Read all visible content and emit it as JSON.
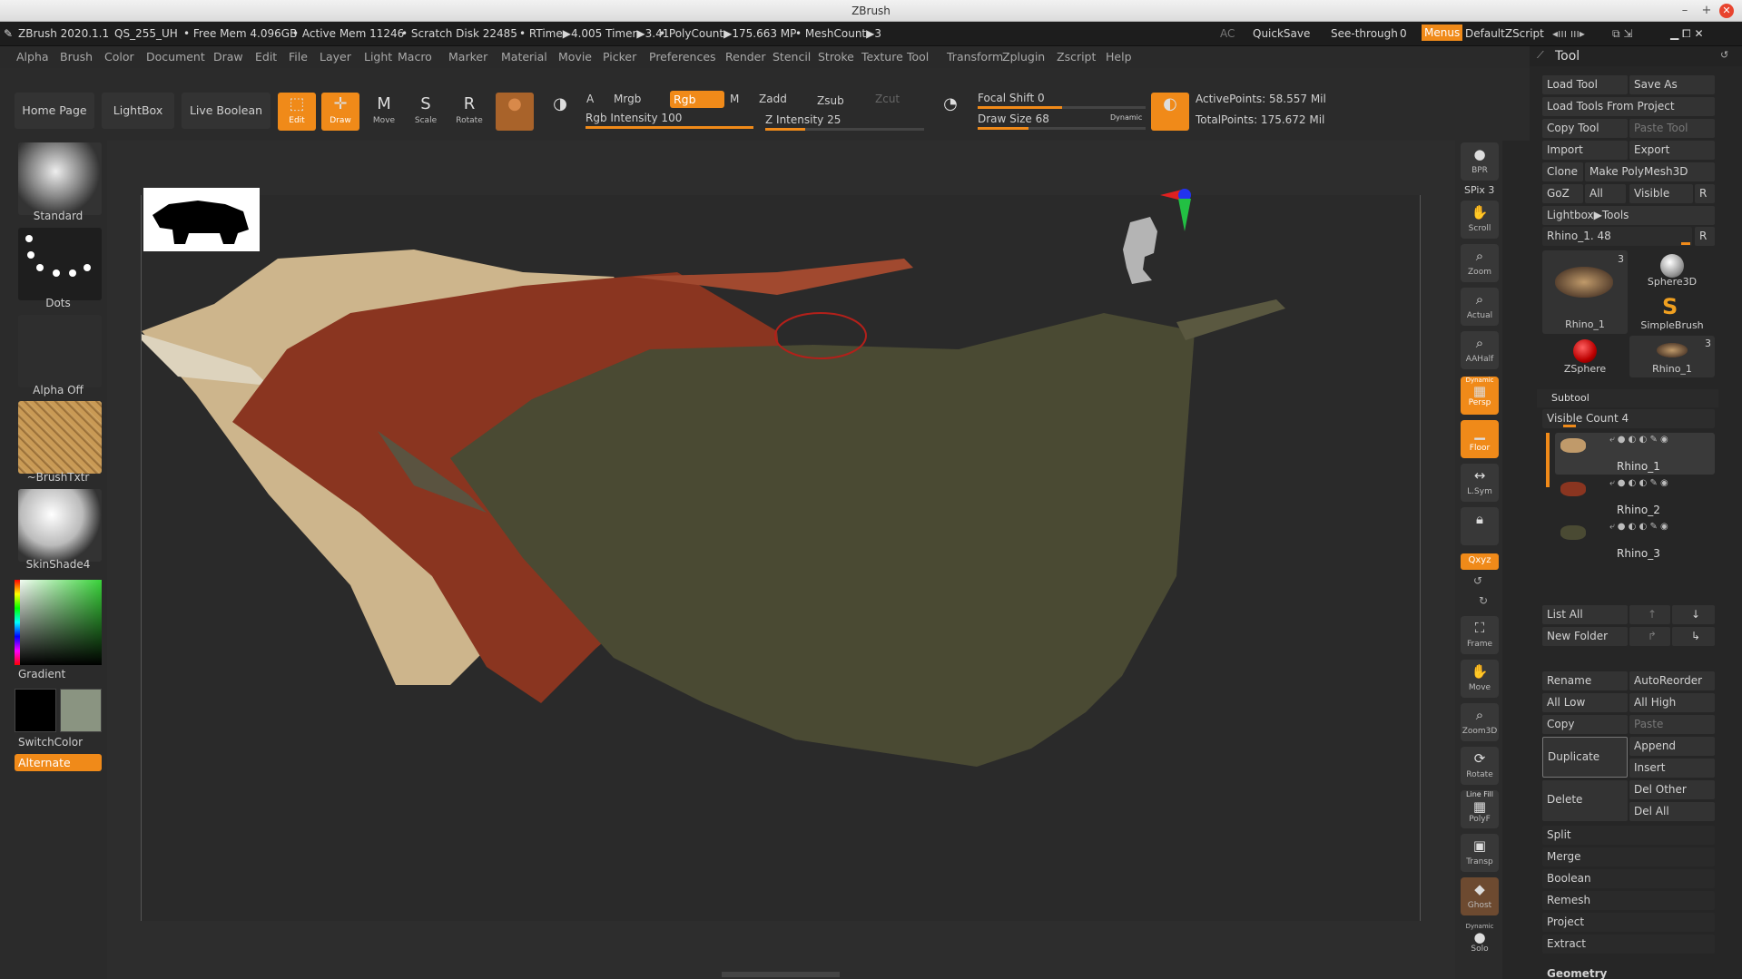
{
  "app": {
    "title": "ZBrush",
    "version": "ZBrush 2020.1.1",
    "script": "QS_255_UH"
  },
  "info": {
    "free_mem": "• Free Mem 4.096GB",
    "active_mem": "• Active Mem 11246",
    "scratch": "• Scratch Disk 22485",
    "rtime": "• RTime▶4.005 Timer▶3.41",
    "polycount": "• PolyCount▶175.663 MP",
    "meshcount": "• MeshCount▶3",
    "ac": "AC",
    "quicksave": "QuickSave",
    "seethrough": "See-through",
    "seethrough_val": "0",
    "menus": "Menus",
    "defaultzscript": "DefaultZScript"
  },
  "menus": [
    "Alpha",
    "Brush",
    "Color",
    "Document",
    "Draw",
    "Edit",
    "File",
    "Layer",
    "Light",
    "Macro",
    "Marker",
    "Material",
    "Movie",
    "Picker",
    "Preferences",
    "Render",
    "Stencil",
    "Stroke",
    "Texture",
    "Tool",
    "Transform",
    "Zplugin",
    "Zscript",
    "Help"
  ],
  "toolbar": {
    "home": "Home Page",
    "lightbox": "LightBox",
    "live_boolean": "Live Boolean",
    "edit": "Edit",
    "draw": "Draw",
    "move": "Move",
    "scale": "Scale",
    "rotate": "Rotate",
    "a": "A",
    "mrgb": "Mrgb",
    "rgb": "Rgb",
    "m": "M",
    "zadd": "Zadd",
    "zsub": "Zsub",
    "zcut": "Zcut",
    "rgb_intensity": "Rgb Intensity 100",
    "z_intensity": "Z Intensity 25",
    "focal_shift": "Focal Shift 0",
    "draw_size": "Draw Size 68",
    "dynamic": "Dynamic",
    "active_points": "ActivePoints: 58.557 Mil",
    "total_points": "TotalPoints: 175.672 Mil",
    "rgb_intensity_level": 1.0,
    "z_intensity_level": 0.25,
    "focal_level": 0.5,
    "draw_size_level": 0.3
  },
  "left": {
    "standard": "Standard",
    "dots": "Dots",
    "alpha_off": "Alpha Off",
    "brushtxtr": "~BrushTxtr",
    "skinshade": "SkinShade4",
    "gradient": "Gradient",
    "switchcolor": "SwitchColor",
    "alternate": "Alternate"
  },
  "right": {
    "bpr": "BPR",
    "spix": "SPix 3",
    "scroll": "Scroll",
    "zoom": "Zoom",
    "actual": "Actual",
    "aahalf": "AAHalf",
    "dynamic": "Dynamic",
    "persp": "Persp",
    "floor": "Floor",
    "lsym": "L.Sym",
    "xyz": "Qxyz",
    "frame": "Frame",
    "move": "Move",
    "zoom3d": "Zoom3D",
    "rotate": "Rotate",
    "linefill": "Line Fill",
    "polyf": "PolyF",
    "transp": "Transp",
    "ghost": "Ghost",
    "dynamic2": "Dynamic",
    "solo": "Solo"
  },
  "tool": {
    "title": "Tool",
    "load_tool": "Load Tool",
    "save_as": "Save As",
    "load_from_project": "Load Tools From Project",
    "copy_tool": "Copy Tool",
    "paste_tool": "Paste Tool",
    "import": "Import",
    "export": "Export",
    "clone": "Clone",
    "make_polymesh": "Make PolyMesh3D",
    "goz": "GoZ",
    "all": "All",
    "visible": "Visible",
    "r": "R",
    "lightbox_tools": "Lightbox▶Tools",
    "current": "Rhino_1. 48",
    "thumbs": [
      {
        "name": "Rhino_1",
        "count": "3"
      },
      {
        "name": "Sphere3D"
      },
      {
        "name": "SimpleBrush"
      },
      {
        "name": "ZSphere"
      },
      {
        "name": "Rhino_1",
        "count": "3"
      }
    ],
    "subtool": "Subtool",
    "visible_count": "Visible Count 4",
    "subtools": [
      "Rhino_1",
      "Rhino_2",
      "Rhino_3"
    ],
    "list_all": "List All",
    "new_folder": "New Folder",
    "rename": "Rename",
    "autoreorder": "AutoReorder",
    "all_low": "All Low",
    "all_high": "All High",
    "copy": "Copy",
    "paste": "Paste",
    "duplicate": "Duplicate",
    "append": "Append",
    "insert": "Insert",
    "delete": "Delete",
    "del_other": "Del Other",
    "del_all": "Del All",
    "split": "Split",
    "merge": "Merge",
    "boolean": "Boolean",
    "remesh": "Remesh",
    "project": "Project",
    "extract": "Extract",
    "geometry": "Geometry"
  },
  "colors": {
    "accent": "#f08a19",
    "bg": "#262626"
  }
}
